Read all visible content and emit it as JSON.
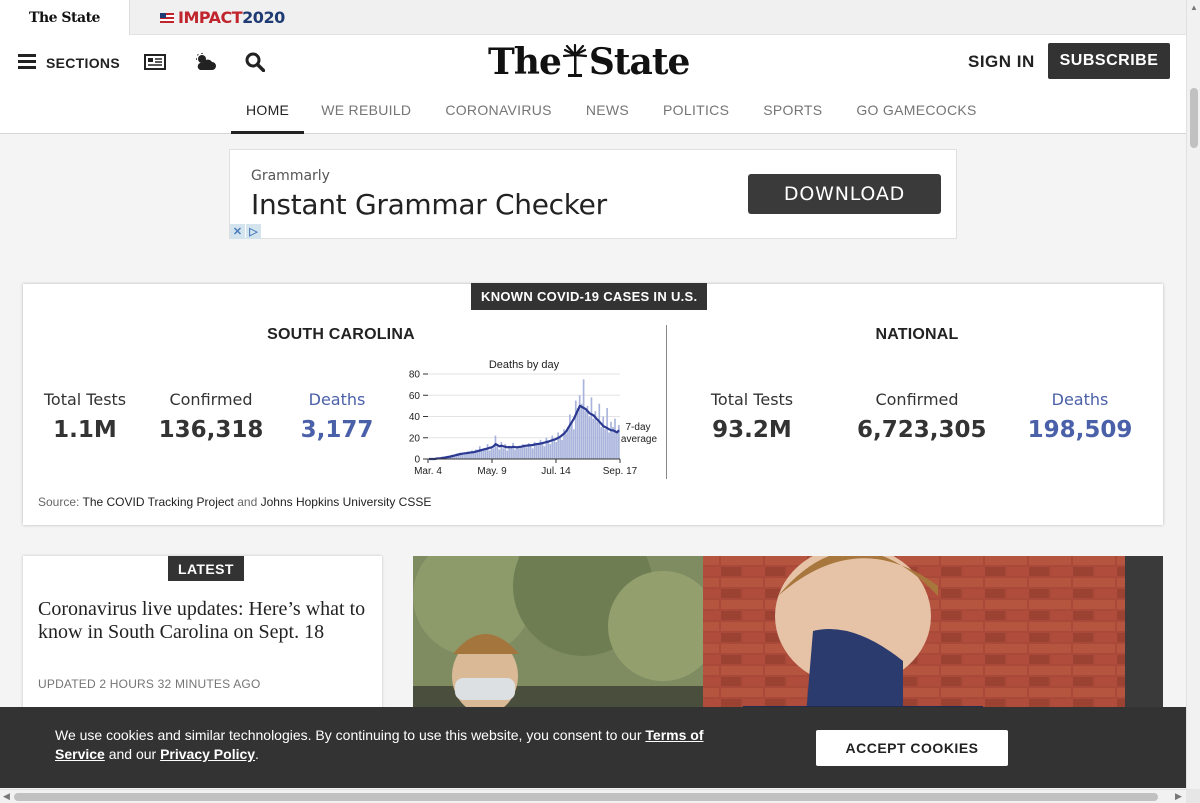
{
  "topstrip": {
    "site_tab": "The State",
    "impact_text": "IMPACT",
    "impact_year": "2020"
  },
  "header": {
    "sections_label": "SECTIONS",
    "logo_left": "The",
    "logo_right": "State",
    "sign_in": "SIGN IN",
    "subscribe": "SUBSCRIBE",
    "nav": [
      "HOME",
      "WE REBUILD",
      "CORONAVIRUS",
      "NEWS",
      "POLITICS",
      "SPORTS",
      "GO GAMECOCKS"
    ],
    "active_nav": "HOME"
  },
  "ad": {
    "brand": "Grammarly",
    "title": "Instant Grammar Checker",
    "button": "DOWNLOAD"
  },
  "covid": {
    "badge": "KNOWN COVID-19 CASES IN U.S.",
    "sc": {
      "title": "SOUTH CAROLINA",
      "tests_label": "Total Tests",
      "tests_value": "1.1M",
      "confirmed_label": "Confirmed",
      "confirmed_value": "136,318",
      "deaths_label": "Deaths",
      "deaths_value": "3,177"
    },
    "national": {
      "title": "NATIONAL",
      "tests_label": "Total Tests",
      "tests_value": "93.2M",
      "confirmed_label": "Confirmed",
      "confirmed_value": "6,723,305",
      "deaths_label": "Deaths",
      "deaths_value": "198,509"
    },
    "source_prefix": "Source:",
    "source_1": "The COVID Tracking Project",
    "source_and": "and",
    "source_2": "Johns Hopkins University CSSE"
  },
  "chart_data": {
    "type": "bar",
    "title": "Deaths by day",
    "ylim": [
      0,
      80
    ],
    "yticks": [
      "0",
      "20",
      "40",
      "60",
      "80"
    ],
    "xticks": [
      "Mar. 4",
      "May. 9",
      "Jul. 14",
      "Sep. 17"
    ],
    "annotation": [
      "7-day",
      "average"
    ],
    "colors": {
      "bars": "#a9b4dc",
      "line": "#2b3990"
    },
    "series": [
      {
        "kind": "bars",
        "values": [
          0,
          0,
          0,
          0,
          1,
          0,
          1,
          1,
          2,
          2,
          3,
          2,
          4,
          3,
          5,
          4,
          6,
          5,
          4,
          6,
          7,
          5,
          8,
          6,
          9,
          7,
          12,
          8,
          10,
          9,
          14,
          8,
          11,
          10,
          22,
          12,
          9,
          16,
          10,
          14,
          8,
          12,
          10,
          15,
          9,
          11,
          10,
          12,
          14,
          13,
          11,
          15,
          12,
          10,
          16,
          14,
          13,
          18,
          15,
          12,
          20,
          17,
          14,
          22,
          18,
          16,
          25,
          20,
          18,
          28,
          24,
          30,
          42,
          35,
          28,
          55,
          48,
          60,
          52,
          75,
          45,
          50,
          40,
          58,
          38,
          45,
          35,
          52,
          30,
          40,
          28,
          48,
          25,
          35,
          30,
          38,
          26,
          32
        ]
      },
      {
        "kind": "line",
        "label": "7-day average",
        "values": [
          0,
          0,
          0,
          0,
          0.5,
          0.6,
          0.8,
          1,
          1.3,
          1.7,
          2,
          2.4,
          2.8,
          3.2,
          3.8,
          4.2,
          4.6,
          5,
          5.3,
          5.5,
          5.7,
          6,
          6.3,
          6.5,
          7,
          7.5,
          8,
          8.5,
          9,
          9.5,
          10,
          10.5,
          11,
          12,
          14,
          13,
          12,
          12.5,
          12,
          11.5,
          11,
          11.3,
          11,
          11.5,
          11.2,
          11,
          11.3,
          11.6,
          12,
          12.4,
          12.6,
          12.8,
          13,
          13.2,
          13.6,
          14,
          14.2,
          14.6,
          15,
          15.4,
          16,
          16.5,
          17,
          17.8,
          18.3,
          19,
          20,
          21,
          22.5,
          24,
          26,
          29,
          32,
          35,
          38,
          42,
          46,
          50,
          49,
          48,
          47,
          45,
          43,
          42,
          41,
          39,
          37,
          35,
          33,
          31,
          30,
          29,
          28,
          27,
          27,
          26,
          25,
          27
        ]
      }
    ]
  },
  "latest": {
    "badge": "LATEST",
    "headline": "Coronavirus live updates: Here’s what to know in South Carolina on Sept. 18",
    "updated": "UPDATED 2 HOURS 32 MINUTES AGO"
  },
  "cookie": {
    "text_1": "We use cookies and similar technologies. By continuing to use this website, you consent to our",
    "terms": "Terms of Service",
    "text_2": "and our",
    "privacy": "Privacy Policy",
    "text_3": ".",
    "accept": "ACCEPT COOKIES"
  }
}
